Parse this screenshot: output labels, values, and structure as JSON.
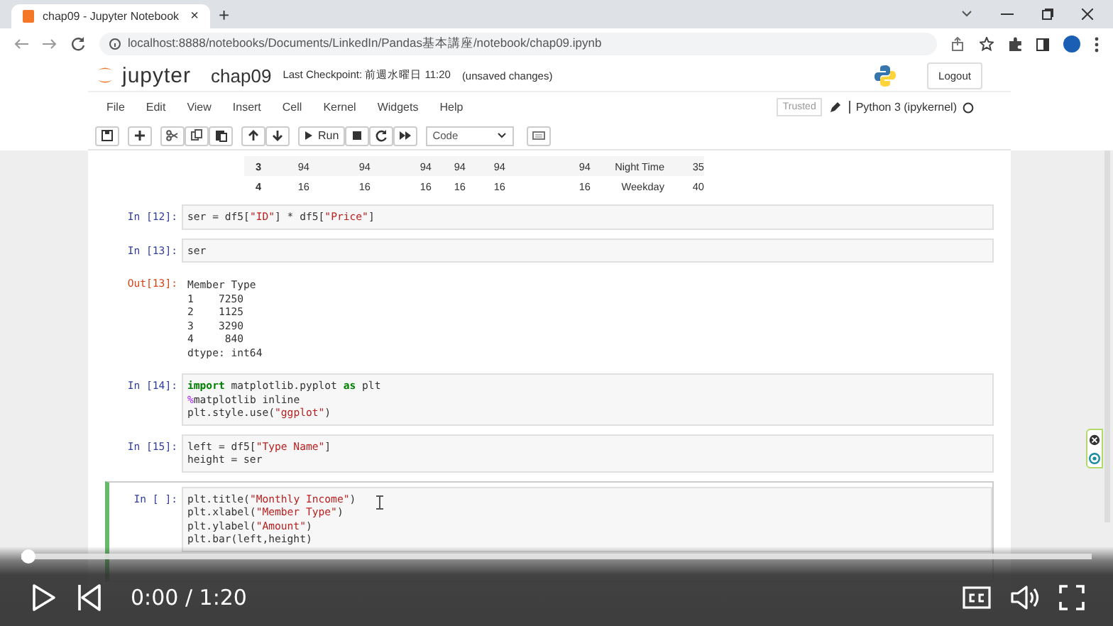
{
  "browser": {
    "tab_title": "chap09 - Jupyter Notebook",
    "tab_close": "×",
    "new_tab": "+",
    "url": "localhost:8888/notebooks/Documents/LinkedIn/Pandas基本講座/notebook/chap09.ipynb"
  },
  "jupyter": {
    "logo": "jupyter",
    "notebook_name": "chap09",
    "checkpoint": "Last Checkpoint: 前週水曜日 11:20",
    "unsaved": "(unsaved changes)",
    "logout": "Logout",
    "trusted": "Trusted",
    "kernel": "Python 3 (ipykernel)"
  },
  "menu": [
    "File",
    "Edit",
    "View",
    "Insert",
    "Cell",
    "Kernel",
    "Widgets",
    "Help"
  ],
  "toolbar": {
    "run": "Run",
    "cell_type": "Code"
  },
  "table_rows": [
    [
      "3",
      "94",
      "94",
      "94",
      "94",
      "94",
      "94",
      "Night Time",
      "35"
    ],
    [
      "4",
      "16",
      "16",
      "16",
      "16",
      "16",
      "16",
      "Weekday",
      "40"
    ]
  ],
  "cells": [
    {
      "kind": "code",
      "prompt": "In [12]:",
      "selected": false,
      "lines": [
        [
          {
            "kind": "plain",
            "text": "ser = df5["
          },
          {
            "kind": "str",
            "text": "\"ID\""
          },
          {
            "kind": "plain",
            "text": "] * df5["
          },
          {
            "kind": "str",
            "text": "\"Price\""
          },
          {
            "kind": "plain",
            "text": "]"
          }
        ]
      ]
    },
    {
      "kind": "code",
      "prompt": "In [13]:",
      "selected": false,
      "lines": [
        [
          {
            "kind": "plain",
            "text": "ser"
          }
        ]
      ]
    },
    {
      "kind": "output",
      "prompt": "Out[13]:",
      "selected": false,
      "lines": [
        [
          {
            "kind": "plain",
            "text": "Member Type"
          }
        ],
        [
          {
            "kind": "plain",
            "text": "1    7250"
          }
        ],
        [
          {
            "kind": "plain",
            "text": "2    1125"
          }
        ],
        [
          {
            "kind": "plain",
            "text": "3    3290"
          }
        ],
        [
          {
            "kind": "plain",
            "text": "4     840"
          }
        ],
        [
          {
            "kind": "plain",
            "text": "dtype: int64"
          }
        ]
      ]
    },
    {
      "kind": "code",
      "prompt": "In [14]:",
      "selected": false,
      "lines": [
        [
          {
            "kind": "kw",
            "text": "import"
          },
          {
            "kind": "plain",
            "text": " matplotlib.pyplot "
          },
          {
            "kind": "kw",
            "text": "as"
          },
          {
            "kind": "plain",
            "text": " plt"
          }
        ],
        [
          {
            "kind": "magic",
            "text": "%"
          },
          {
            "kind": "plain",
            "text": "matplotlib inline"
          }
        ],
        [
          {
            "kind": "plain",
            "text": "plt.style.use("
          },
          {
            "kind": "str",
            "text": "\"ggplot\""
          },
          {
            "kind": "plain",
            "text": ")"
          }
        ]
      ]
    },
    {
      "kind": "code",
      "prompt": "In [15]:",
      "selected": false,
      "lines": [
        [
          {
            "kind": "plain",
            "text": "left = df5["
          },
          {
            "kind": "str",
            "text": "\"Type Name\""
          },
          {
            "kind": "plain",
            "text": "]"
          }
        ],
        [
          {
            "kind": "plain",
            "text": "height = ser"
          }
        ]
      ]
    },
    {
      "kind": "code",
      "prompt": "In [ ]:",
      "selected": true,
      "lines": [
        [
          {
            "kind": "plain",
            "text": "plt.title("
          },
          {
            "kind": "str",
            "text": "\"Monthly Income\""
          },
          {
            "kind": "plain",
            "text": ")"
          }
        ],
        [
          {
            "kind": "plain",
            "text": "plt.xlabel("
          },
          {
            "kind": "str",
            "text": "\"Member Type\""
          },
          {
            "kind": "plain",
            "text": ")"
          }
        ],
        [
          {
            "kind": "plain",
            "text": "plt.ylabel("
          },
          {
            "kind": "str",
            "text": "\"Amount\""
          },
          {
            "kind": "plain",
            "text": ")"
          }
        ],
        [
          {
            "kind": "plain",
            "text": "plt.bar(left,height)"
          }
        ]
      ]
    }
  ],
  "video": {
    "progress": {
      "level": 0
    },
    "time": "0:00 / 1:20"
  }
}
